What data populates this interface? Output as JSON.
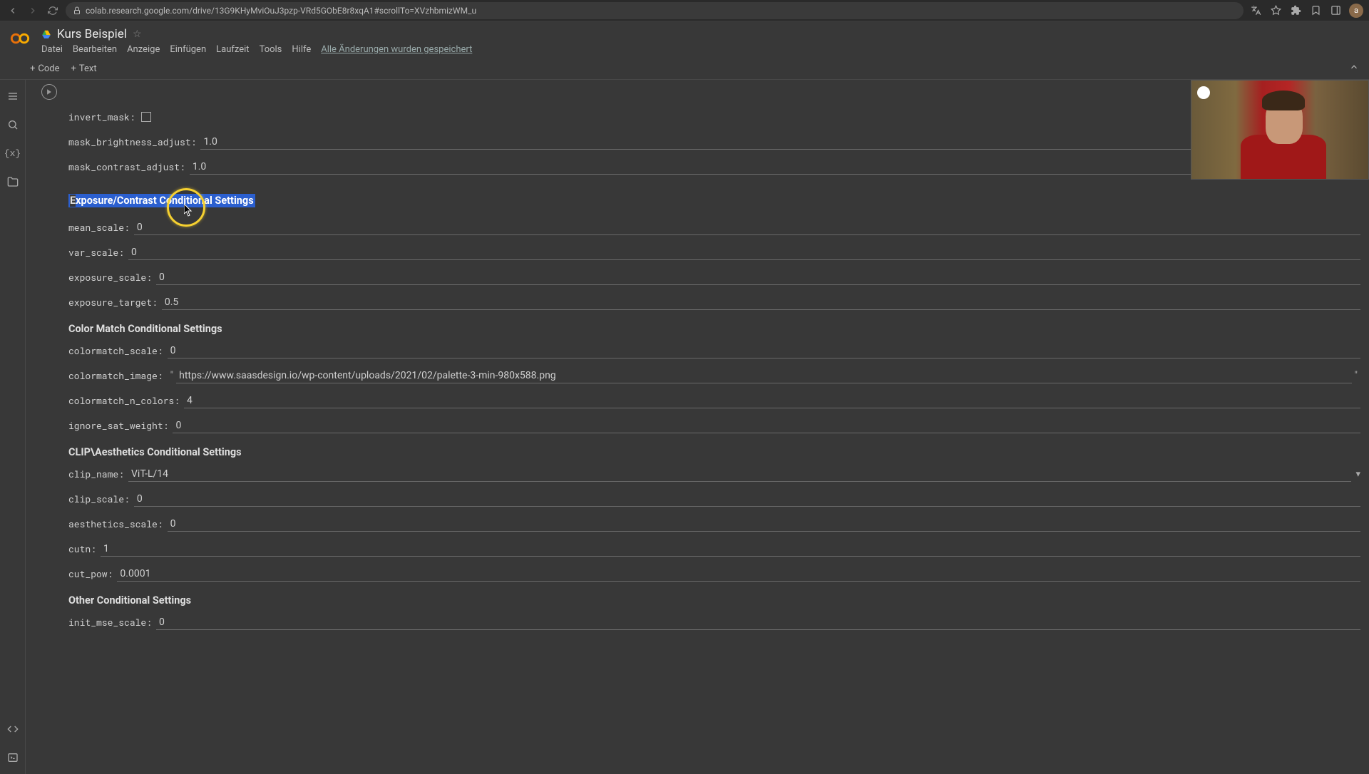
{
  "browser": {
    "url": "colab.research.google.com/drive/13G9KHyMviOuJ3pzp-VRd5GObE8r8xqA1#scrollTo=XVzhbmizWM_u",
    "avatar_initial": "a"
  },
  "header": {
    "doc_title": "Kurs Beispiel",
    "menu": [
      "Datei",
      "Bearbeiten",
      "Anzeige",
      "Einfügen",
      "Laufzeit",
      "Tools",
      "Hilfe"
    ],
    "saved_status": "Alle Änderungen wurden gespeichert"
  },
  "toolbar": {
    "code_btn": "Code",
    "text_btn": "Text"
  },
  "form": {
    "invert_mask": {
      "label": "invert_mask:",
      "checked": false
    },
    "mask_brightness_adjust": {
      "label": "mask_brightness_adjust:",
      "value": "1.0"
    },
    "mask_contrast_adjust": {
      "label": "mask_contrast_adjust:",
      "value": "1.0"
    },
    "section_exposure": "Exposure/Contrast Conditional Settings",
    "mean_scale": {
      "label": "mean_scale:",
      "value": "0"
    },
    "var_scale": {
      "label": "var_scale:",
      "value": "0"
    },
    "exposure_scale": {
      "label": "exposure_scale:",
      "value": "0"
    },
    "exposure_target": {
      "label": "exposure_target:",
      "value": "0.5"
    },
    "section_colormatch": "Color Match Conditional Settings",
    "colormatch_scale": {
      "label": "colormatch_scale:",
      "value": "0"
    },
    "colormatch_image": {
      "label": "colormatch_image:",
      "value": "https://www.saasdesign.io/wp-content/uploads/2021/02/palette-3-min-980x588.png"
    },
    "colormatch_n_colors": {
      "label": "colormatch_n_colors:",
      "value": "4"
    },
    "ignore_sat_weight": {
      "label": "ignore_sat_weight:",
      "value": "0"
    },
    "section_clip": "CLIP\\Aesthetics Conditional Settings",
    "clip_name": {
      "label": "clip_name:",
      "value": "ViT-L/14"
    },
    "clip_scale": {
      "label": "clip_scale:",
      "value": "0"
    },
    "aesthetics_scale": {
      "label": "aesthetics_scale:",
      "value": "0"
    },
    "cutn": {
      "label": "cutn:",
      "value": "1"
    },
    "cut_pow": {
      "label": "cut_pow:",
      "value": "0.0001"
    },
    "section_other": "Other Conditional Settings",
    "init_mse_scale": {
      "label": "init_mse_scale:",
      "value": "0"
    }
  }
}
